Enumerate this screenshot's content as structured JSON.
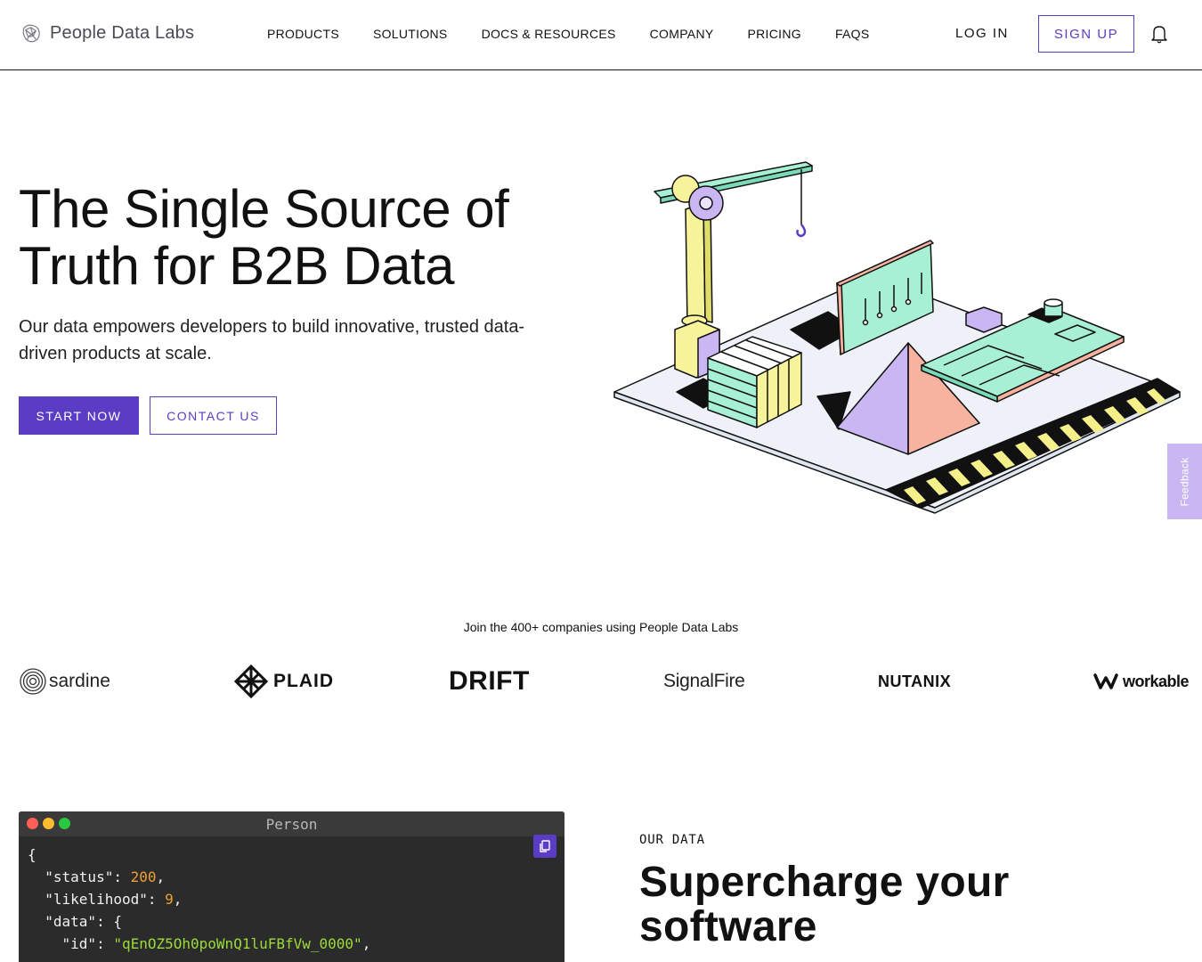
{
  "nav": {
    "brand": "People Data Labs",
    "links": [
      "PRODUCTS",
      "SOLUTIONS",
      "DOCS & RESOURCES",
      "COMPANY",
      "PRICING",
      "FAQS"
    ],
    "login": "LOG IN",
    "signup": "SIGN UP"
  },
  "hero": {
    "title_line1": "The Single Source of",
    "title_line2": "Truth for B2B Data",
    "subtitle": "Our data empowers developers to build innovative, trusted data-driven products at scale.",
    "cta_primary": "START NOW",
    "cta_secondary": "CONTACT US"
  },
  "feedback": "Feedback",
  "customers": {
    "heading": "Join the 400+ companies using People Data Labs",
    "logos": [
      "sardine",
      "PLAID",
      "DRIFT",
      "SignalFire",
      "NUTANIX",
      "workable"
    ]
  },
  "code": {
    "title": "Person",
    "open_brace": "{",
    "lines": [
      {
        "key": "\"status\"",
        "value": "200",
        "type": "num"
      },
      {
        "key": "\"likelihood\"",
        "value": "9",
        "type": "num"
      },
      {
        "key": "\"data\"",
        "value": "{",
        "type": "plain"
      },
      {
        "key": "\"id\"",
        "value": "\"qEnOZ5Oh0poWnQ1luFBfVw_0000\"",
        "type": "str"
      }
    ]
  },
  "our_data": {
    "eyebrow": "OUR DATA",
    "title": "Supercharge your software"
  },
  "colors": {
    "accent": "#5b3cc4",
    "feedback_bg": "#c9b6f2",
    "code_bg": "#2b2b2b",
    "code_num": "#f0a030",
    "code_str": "#9cdb3a"
  }
}
